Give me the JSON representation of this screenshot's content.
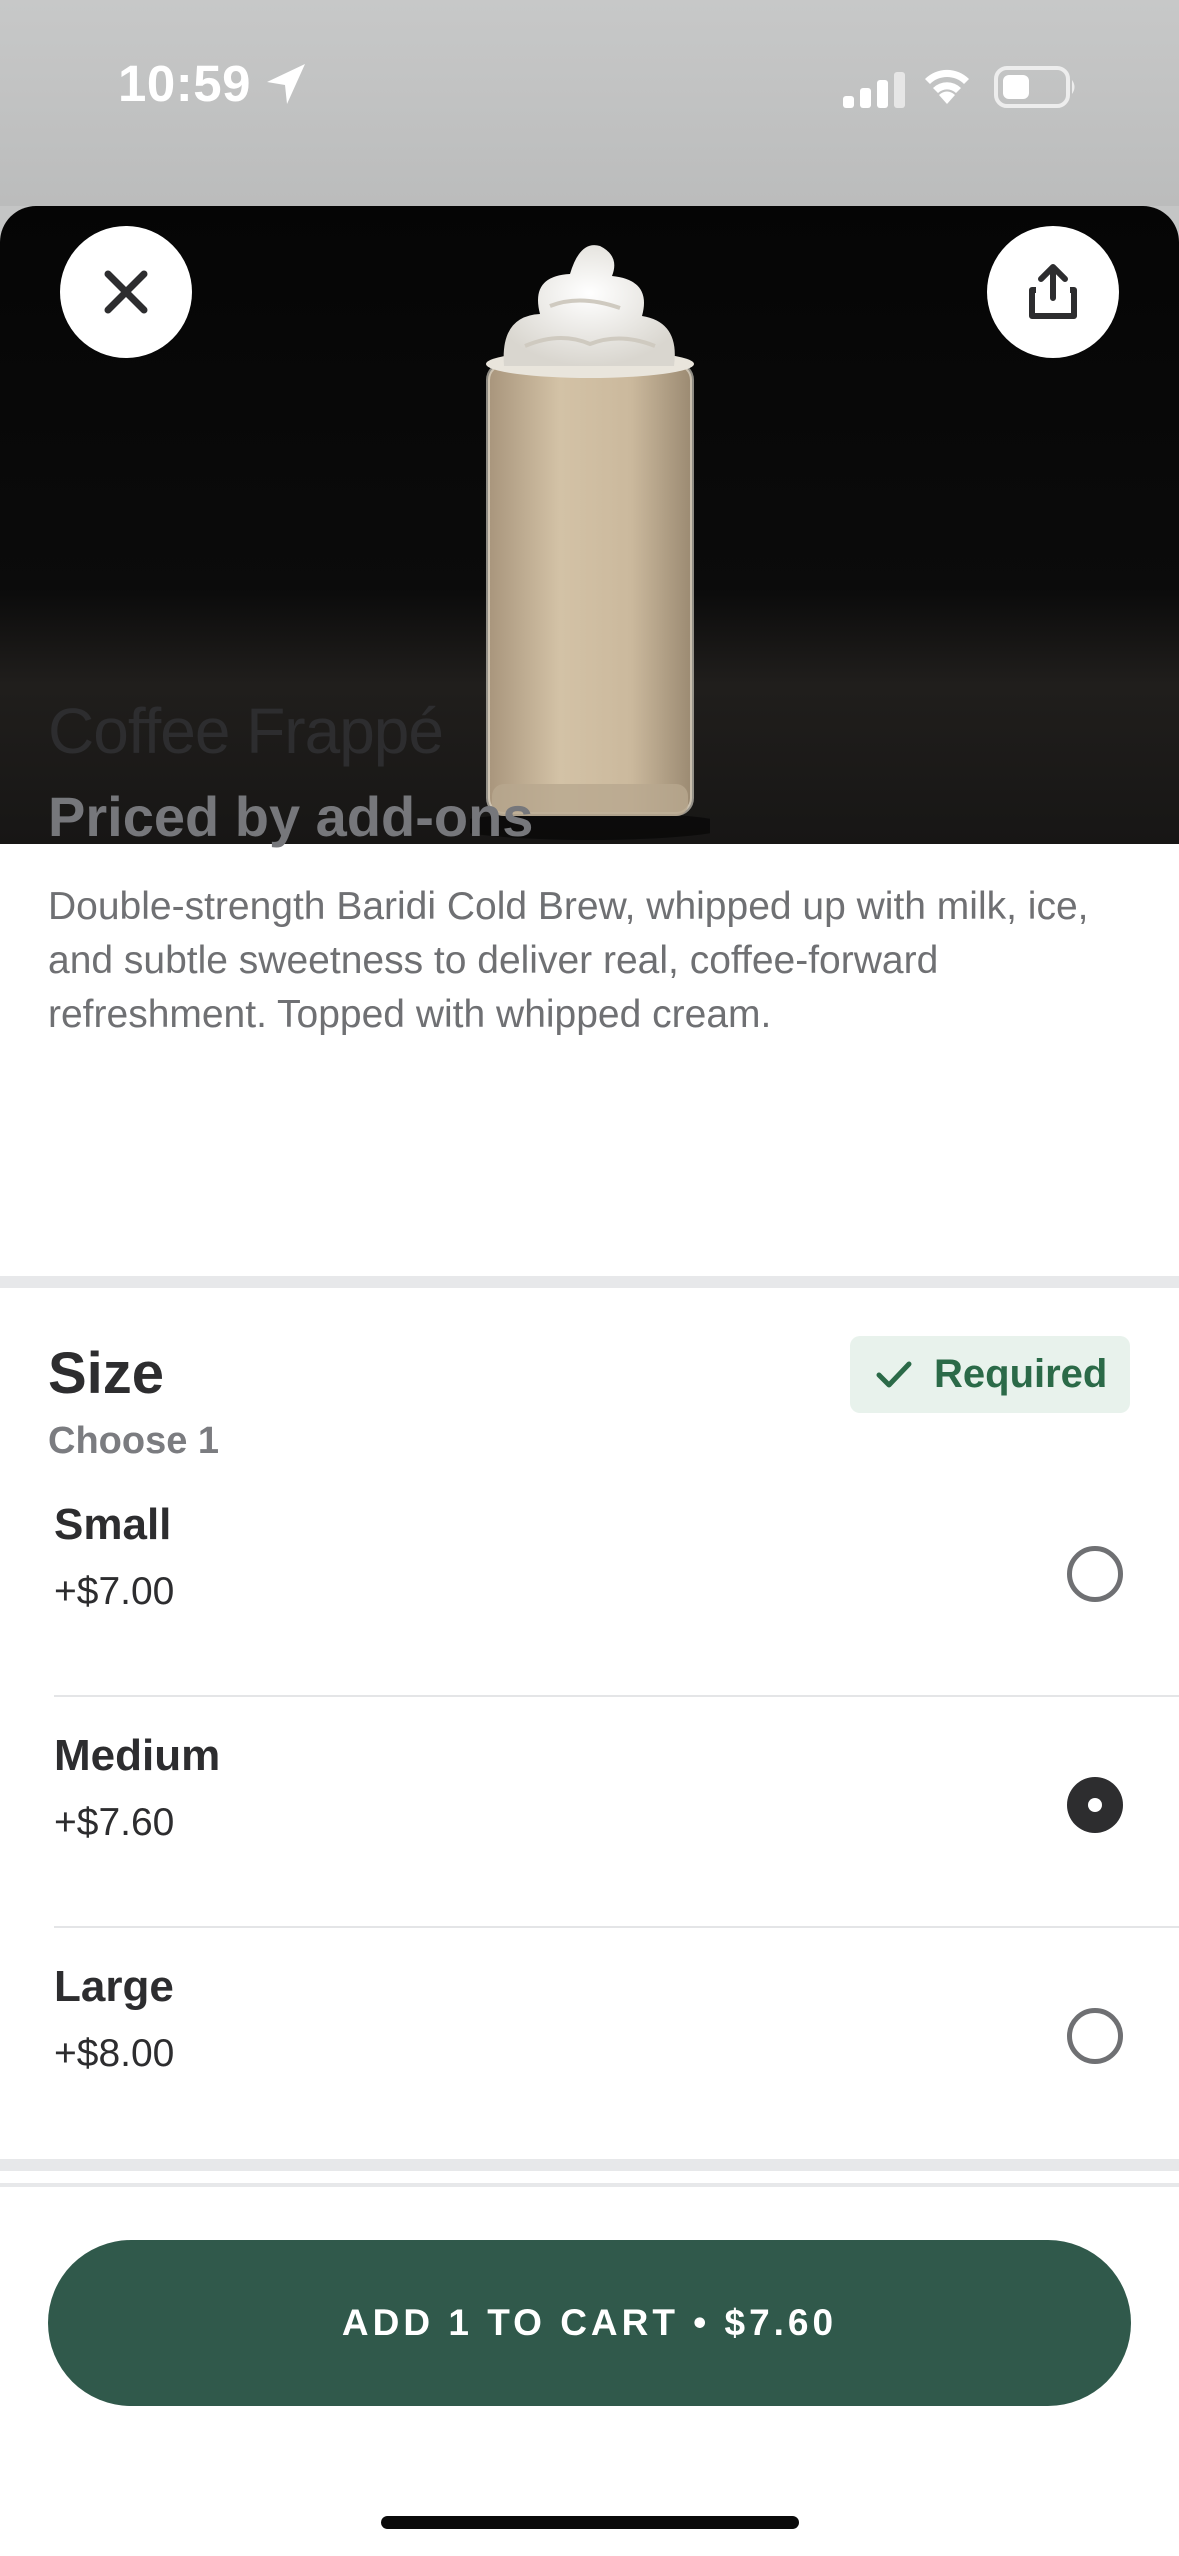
{
  "status_bar": {
    "time": "10:59"
  },
  "product": {
    "title": "Coffee Frappé",
    "subtitle": "Priced by add-ons",
    "description": "Double-strength Baridi Cold Brew, whipped up with milk, ice, and subtle sweetness to deliver real, coffee-forward refreshment. Topped with whipped cream."
  },
  "size_section": {
    "title": "Size",
    "subtitle": "Choose 1",
    "badge": "Required",
    "options": [
      {
        "name": "Small",
        "price": "+$7.00",
        "selected": false
      },
      {
        "name": "Medium",
        "price": "+$7.60",
        "selected": true
      },
      {
        "name": "Large",
        "price": "+$8.00",
        "selected": false
      }
    ]
  },
  "cart_button": {
    "label": "ADD 1 TO CART • $7.60"
  },
  "icons": {
    "close": "close-icon",
    "share": "share-icon",
    "location": "location-arrow-icon",
    "signal": "signal-icon",
    "wifi": "wifi-icon",
    "battery": "battery-icon",
    "check": "check-icon"
  },
  "colors": {
    "accent": "#30594b",
    "badge_bg": "#e8f2ec",
    "badge_text": "#2b6a48",
    "text_primary": "#2d2d2f",
    "text_secondary": "#76777b"
  }
}
